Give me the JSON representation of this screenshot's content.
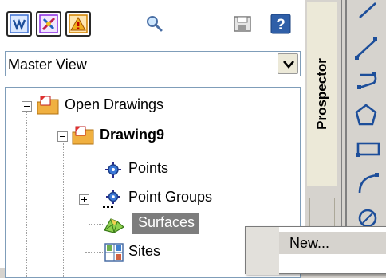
{
  "toolbar": {
    "buttons": [
      {
        "name": "prospector-toggle-icon",
        "color": "#3c6fd0"
      },
      {
        "name": "settings-toggle-icon",
        "color": "#8a2be2"
      },
      {
        "name": "event-viewer-icon",
        "color": "#d08000"
      }
    ],
    "search_icon": "magnifier-icon",
    "save_icon": "save-disk-icon",
    "help_label": "?"
  },
  "view_select": {
    "value": "Master View"
  },
  "tree": {
    "root": {
      "label": "Open Drawings",
      "expander": "minus"
    },
    "drawing": {
      "label": "Drawing9",
      "expander": "minus"
    },
    "children": [
      {
        "label": "Points",
        "icon": "points-icon"
      },
      {
        "label": "Point Groups",
        "icon": "point-groups-icon",
        "expander": "plus"
      },
      {
        "label": "Surfaces",
        "icon": "surfaces-icon",
        "selected": true
      },
      {
        "label": "Sites",
        "icon": "sites-icon"
      }
    ]
  },
  "side_tab": {
    "label": "Prospector"
  },
  "draw_tools": [
    "line-icon",
    "construction-line-icon",
    "polyline-icon",
    "polygon-icon",
    "rectangle-icon",
    "arc-icon",
    "circle-icon"
  ],
  "context_menu": {
    "items": [
      "New..."
    ]
  },
  "colors": {
    "selection": "#7d7d7d",
    "folder": "#f0b040",
    "accent": "#1d4e9a"
  }
}
